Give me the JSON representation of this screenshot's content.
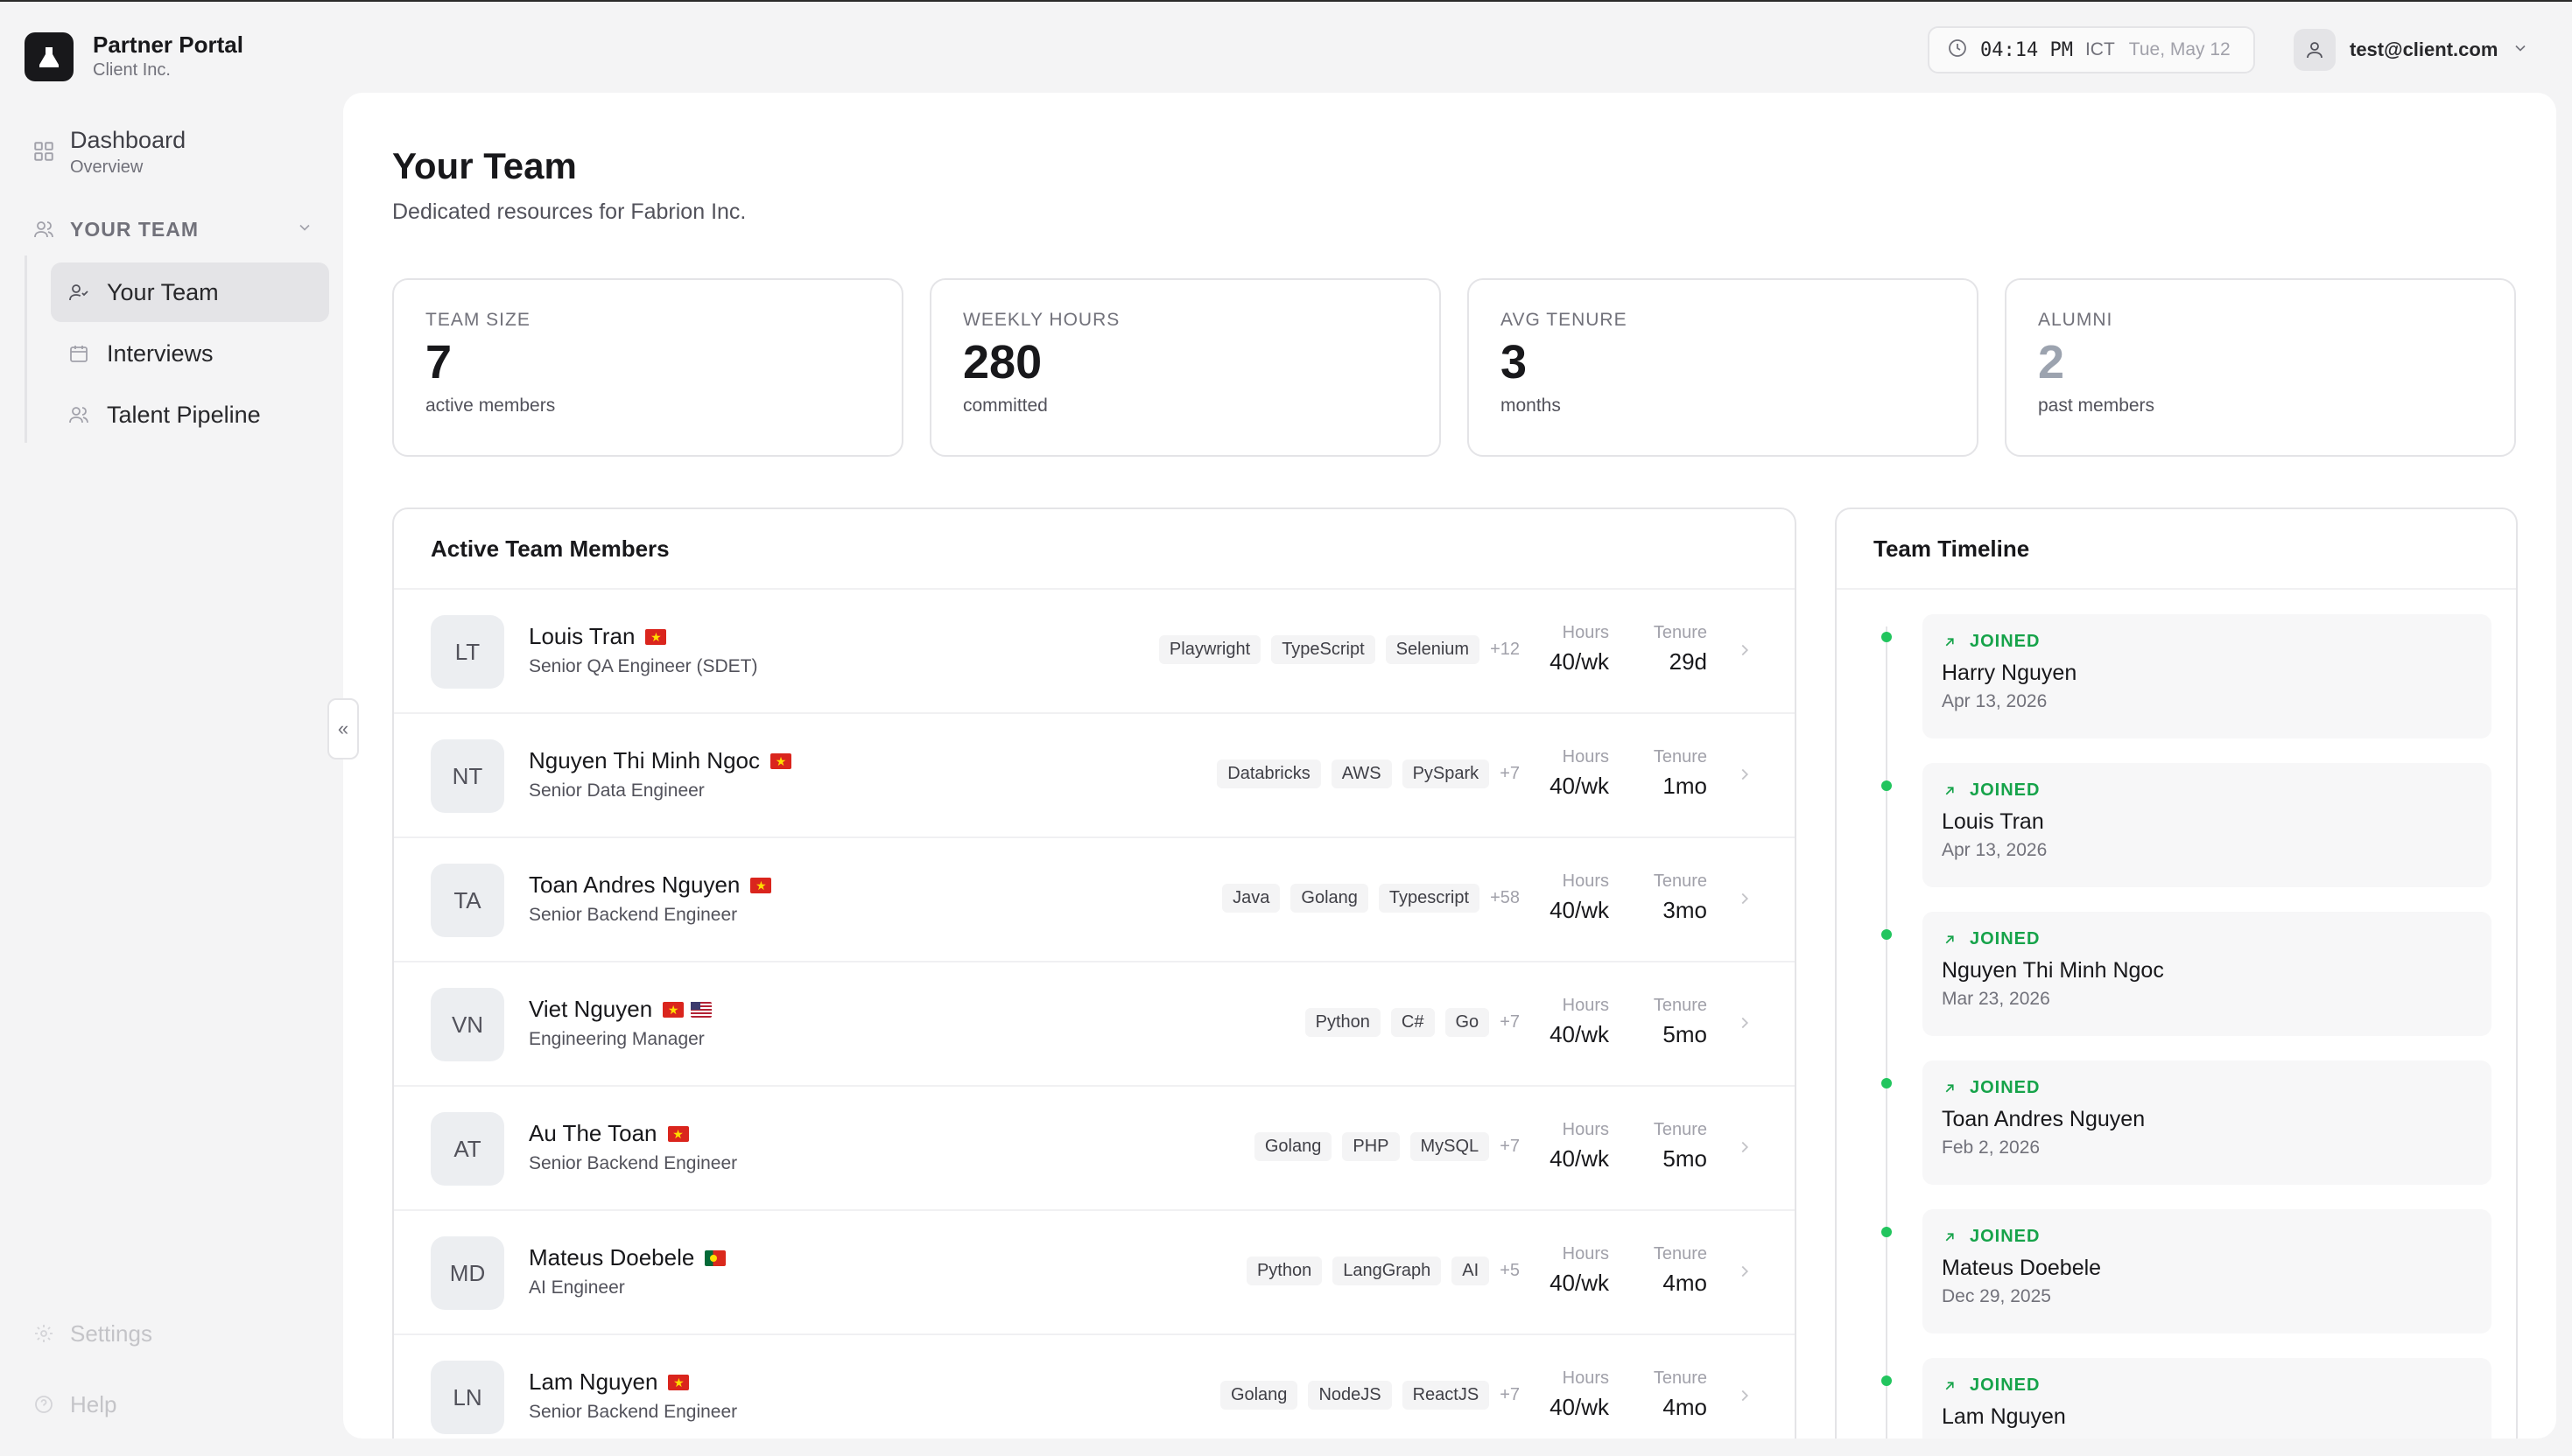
{
  "brand": {
    "title": "Partner Portal",
    "subtitle": "Client Inc."
  },
  "sidebar": {
    "dashboard": {
      "label": "Dashboard",
      "sub": "Overview"
    },
    "section": "YOUR TEAM",
    "items": [
      {
        "label": "Your Team",
        "active": true,
        "icon": "user-check-icon"
      },
      {
        "label": "Interviews",
        "active": false,
        "icon": "calendar-icon"
      },
      {
        "label": "Talent Pipeline",
        "active": false,
        "icon": "users-icon"
      }
    ],
    "settings": "Settings",
    "help": "Help"
  },
  "topbar": {
    "time": "04:14 PM",
    "timezone": "ICT",
    "date": "Tue, May 12",
    "user_email": "test@client.com"
  },
  "page": {
    "title": "Your Team",
    "subtitle": "Dedicated resources for Fabrion Inc."
  },
  "stats": [
    {
      "label": "TEAM SIZE",
      "value": "7",
      "caption": "active members"
    },
    {
      "label": "WEEKLY HOURS",
      "value": "280",
      "caption": "committed"
    },
    {
      "label": "AVG TENURE",
      "value": "3",
      "caption": "months"
    },
    {
      "label": "ALUMNI",
      "value": "2",
      "caption": "past members"
    }
  ],
  "members_card": {
    "title": "Active Team Members",
    "hours_label": "Hours",
    "tenure_label": "Tenure",
    "rows": [
      {
        "initials": "LT",
        "name": "Louis Tran",
        "flags": [
          "vn"
        ],
        "role": "Senior QA Engineer (SDET)",
        "skills": [
          "Playwright",
          "TypeScript",
          "Selenium"
        ],
        "more": "+12",
        "hours": "40/wk",
        "tenure": "29d"
      },
      {
        "initials": "NT",
        "name": "Nguyen Thi Minh Ngoc",
        "flags": [
          "vn"
        ],
        "role": "Senior Data Engineer",
        "skills": [
          "Databricks",
          "AWS",
          "PySpark"
        ],
        "more": "+7",
        "hours": "40/wk",
        "tenure": "1mo"
      },
      {
        "initials": "TA",
        "name": "Toan Andres Nguyen",
        "flags": [
          "vn"
        ],
        "role": "Senior Backend Engineer",
        "skills": [
          "Java",
          "Golang",
          "Typescript"
        ],
        "more": "+58",
        "hours": "40/wk",
        "tenure": "3mo"
      },
      {
        "initials": "VN",
        "name": "Viet Nguyen",
        "flags": [
          "vn",
          "us"
        ],
        "role": "Engineering Manager",
        "skills": [
          "Python",
          "C#",
          "Go"
        ],
        "more": "+7",
        "hours": "40/wk",
        "tenure": "5mo"
      },
      {
        "initials": "AT",
        "name": "Au The Toan",
        "flags": [
          "vn"
        ],
        "role": "Senior Backend Engineer",
        "skills": [
          "Golang",
          "PHP",
          "MySQL"
        ],
        "more": "+7",
        "hours": "40/wk",
        "tenure": "5mo"
      },
      {
        "initials": "MD",
        "name": "Mateus Doebele",
        "flags": [
          "pt"
        ],
        "role": "AI Engineer",
        "skills": [
          "Python",
          "LangGraph",
          "AI"
        ],
        "more": "+5",
        "hours": "40/wk",
        "tenure": "4mo"
      },
      {
        "initials": "LN",
        "name": "Lam Nguyen",
        "flags": [
          "vn"
        ],
        "role": "Senior Backend Engineer",
        "skills": [
          "Golang",
          "NodeJS",
          "ReactJS"
        ],
        "more": "+7",
        "hours": "40/wk",
        "tenure": "4mo"
      }
    ]
  },
  "timeline_card": {
    "title": "Team Timeline",
    "events": [
      {
        "type": "JOINED",
        "name": "Harry Nguyen",
        "date": "Apr 13, 2026"
      },
      {
        "type": "JOINED",
        "name": "Louis Tran",
        "date": "Apr 13, 2026"
      },
      {
        "type": "JOINED",
        "name": "Nguyen Thi Minh Ngoc",
        "date": "Mar 23, 2026"
      },
      {
        "type": "JOINED",
        "name": "Toan Andres Nguyen",
        "date": "Feb 2, 2026"
      },
      {
        "type": "JOINED",
        "name": "Mateus Doebele",
        "date": "Dec 29, 2025"
      },
      {
        "type": "JOINED",
        "name": "Lam Nguyen",
        "date": ""
      }
    ]
  },
  "colors": {
    "accent_green": "#22c55e",
    "sidebar_bg": "#f4f4f5",
    "active_item_bg": "#e4e4e7"
  }
}
